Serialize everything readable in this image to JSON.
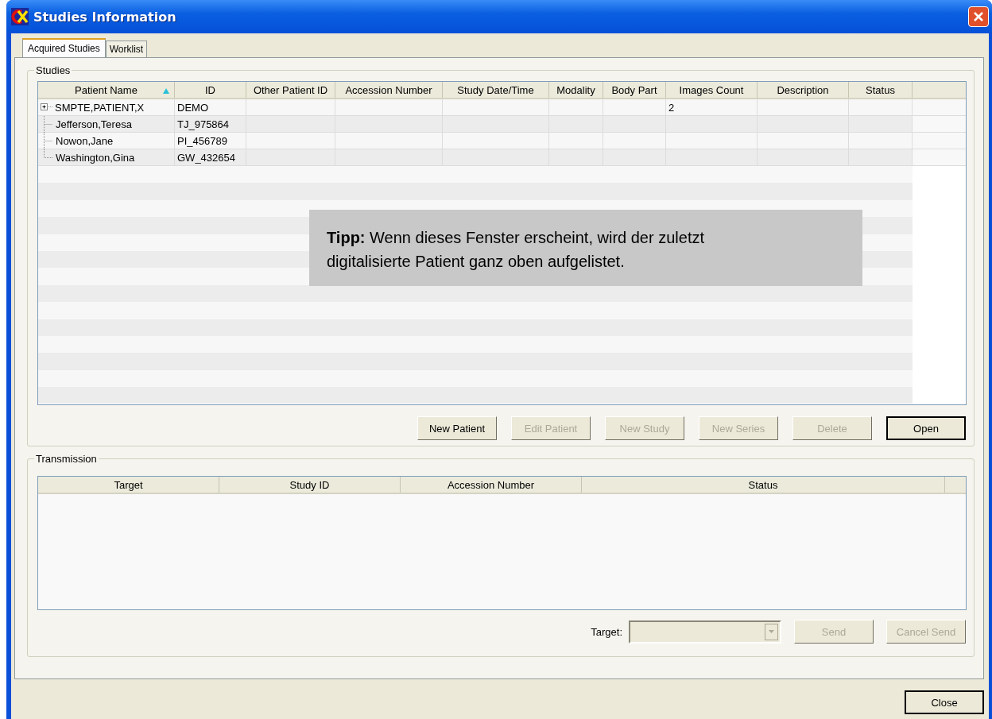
{
  "window": {
    "title": "Studies Information"
  },
  "tabs": [
    {
      "label": "Acquired Studies",
      "selected": true
    },
    {
      "label": "Worklist",
      "selected": false
    }
  ],
  "studies": {
    "title": "Studies",
    "columns": [
      {
        "label": "Patient Name",
        "sorted": true
      },
      {
        "label": "ID",
        "sorted": false
      },
      {
        "label": "Other Patient ID",
        "sorted": false
      },
      {
        "label": "Accession Number",
        "sorted": false
      },
      {
        "label": "Study Date/Time",
        "sorted": false
      },
      {
        "label": "Modality",
        "sorted": false
      },
      {
        "label": "Body Part",
        "sorted": false
      },
      {
        "label": "Images Count",
        "sorted": false
      },
      {
        "label": "Description",
        "sorted": false
      },
      {
        "label": "Status",
        "sorted": false
      }
    ],
    "rows": [
      {
        "kind": "collapsed",
        "patient_name": "SMPTE,PATIENT,X",
        "id": "DEMO",
        "images_count": "2"
      },
      {
        "kind": "leaf",
        "patient_name": "Jefferson,Teresa",
        "id": "TJ_975864"
      },
      {
        "kind": "leaf",
        "patient_name": "Nowon,Jane",
        "id": "PI_456789"
      },
      {
        "kind": "leaf",
        "patient_name": "Washington,Gina",
        "id": "GW_432654"
      }
    ],
    "tip": "**Tipp:** Wenn dieses Fenster erscheint, wird der zuletzt digitalisierte Patient ganz oben aufgelistet.",
    "buttons": [
      {
        "label": "New Patient",
        "disabled": false,
        "default": false
      },
      {
        "label": "Edit Patient",
        "disabled": true,
        "default": false
      },
      {
        "label": "New Study",
        "disabled": true,
        "default": false
      },
      {
        "label": "New Series",
        "disabled": true,
        "default": false
      },
      {
        "label": "Delete",
        "disabled": true,
        "default": false
      },
      {
        "label": "Open",
        "disabled": false,
        "default": true
      }
    ]
  },
  "transmission": {
    "title": "Transmission",
    "columns": [
      "Target",
      "Study ID",
      "Accession Number",
      "Status"
    ],
    "target_label": "Target:",
    "target_disabled": true,
    "buttons": [
      {
        "label": "Send",
        "disabled": true
      },
      {
        "label": "Cancel Send",
        "disabled": true
      }
    ]
  },
  "close_button": "Close"
}
